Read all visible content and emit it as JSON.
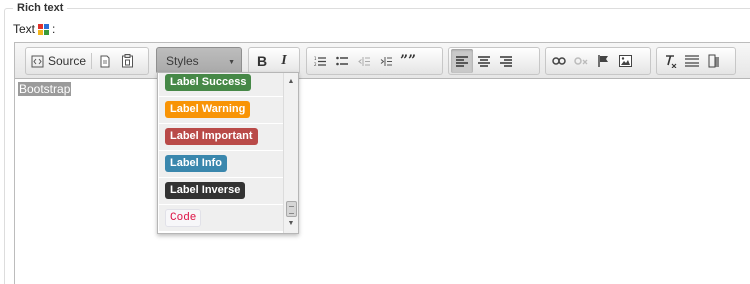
{
  "fieldset": {
    "legend": "Rich text",
    "field_label": "Text",
    "label_suffix": ":"
  },
  "toolbar": {
    "source_label": "Source",
    "styles_label": "Styles",
    "bold_label": "B",
    "italic_label": "I",
    "blockquote_label": "””"
  },
  "editor": {
    "content": "Bootstrap"
  },
  "styles_dropdown": {
    "items": [
      {
        "label": "Label Success",
        "color": "#468847"
      },
      {
        "label": "Label Warning",
        "color": "#f89406"
      },
      {
        "label": "Label Important",
        "color": "#b94a48"
      },
      {
        "label": "Label Info",
        "color": "#3a87ad"
      },
      {
        "label": "Label Inverse",
        "color": "#333333"
      },
      {
        "label": "Code",
        "color": "#dd1144"
      }
    ]
  },
  "colors": {
    "toolbar_bg": "#e6e6e6",
    "active_button": "#c9c9c9",
    "selection": "#9b9b9b"
  }
}
